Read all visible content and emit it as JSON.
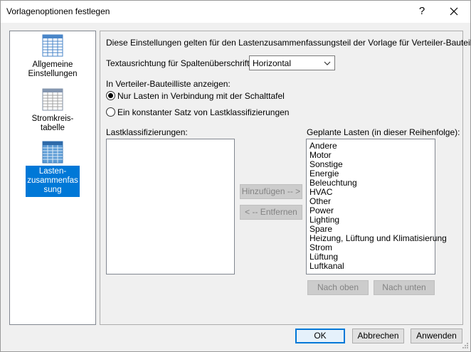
{
  "window": {
    "title": "Vorlagenoptionen festlegen",
    "help_label": "?"
  },
  "nav": [
    {
      "label": "Allgemeine Einstellungen",
      "line1": "Allgemeine",
      "line2": "Einstellungen",
      "icon": "general-settings-icon"
    },
    {
      "label": "Stromkreis-tabelle",
      "line1": "Stromkreis-",
      "line2": "tabelle",
      "icon": "circuit-table-icon"
    },
    {
      "label": "Lasten-zusammenfassung",
      "line1": "Lasten-",
      "line2": "zusammenfas",
      "line3": "sung",
      "icon": "load-summary-icon",
      "selected": true
    }
  ],
  "content": {
    "description": "Diese Einstellungen gelten für den Lastenzusammenfassungsteil der Vorlage für Verteiler-Bauteillisten.",
    "direction_label": "Textausrichtung für Spaltenüberschrift:",
    "direction_value": "Horizontal",
    "show_label": "In Verteiler-Bauteilliste anzeigen:",
    "radio_1": "Nur Lasten in Verbindung mit der Schalttafel",
    "radio_2": "Ein konstanter Satz von Lastklassifizierungen",
    "radio_selected": 1,
    "left_list_label": "Lastklassifizierungen:",
    "right_list_label": "Geplante Lasten (in dieser Reihenfolge):",
    "planned_loads": [
      "Andere",
      "Motor",
      "Sonstige",
      "Energie",
      "Beleuchtung",
      "HVAC",
      "Other",
      "Power",
      "Lighting",
      "Spare",
      "Heizung, Lüftung und Klimatisierung",
      "Strom",
      "Lüftung",
      "Luftkanal"
    ],
    "add_button": "Hinzufügen -- >",
    "remove_button": "< -- Entfernen",
    "up_button": "Nach oben",
    "down_button": "Nach unten"
  },
  "footer": {
    "ok": "OK",
    "cancel": "Abbrechen",
    "apply": "Anwenden"
  },
  "colors": {
    "accent": "#0078d7",
    "icon_blue": "#4a86c8"
  }
}
